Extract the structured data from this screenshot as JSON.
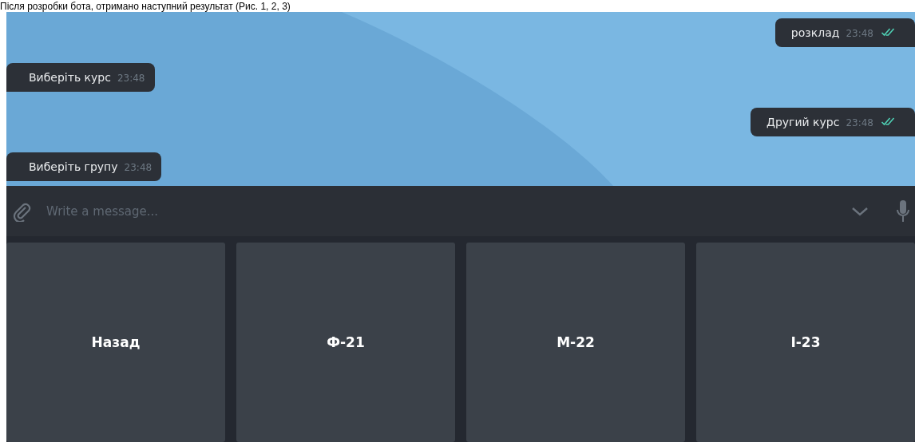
{
  "caption": "Після розробки бота, отримано наступний результат (Рис. 1, 2, 3)",
  "messages": [
    {
      "kind": "outgoing",
      "text": "розклад",
      "time": "23:48",
      "read": true
    },
    {
      "kind": "incoming",
      "text": "Виберіть курс",
      "time": "23:48"
    },
    {
      "kind": "outgoing",
      "text": "Другий курс",
      "time": "23:48",
      "read": true
    },
    {
      "kind": "incoming",
      "text": "Виберіть групу",
      "time": "23:48"
    }
  ],
  "composer": {
    "placeholder": "Write a message..."
  },
  "keyboard": [
    "Назад",
    "Ф-21",
    "М-22",
    "І-23"
  ]
}
